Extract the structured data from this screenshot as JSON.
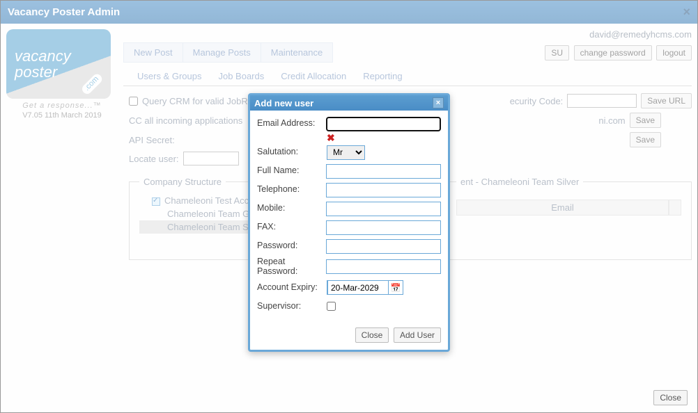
{
  "window": {
    "title": "Vacancy Poster Admin"
  },
  "logo": {
    "line1": "vacancy",
    "line2": "poster",
    "com": ".com",
    "tagline": "Get a response...™",
    "version": "V7.05 11th March 2019"
  },
  "user_email": "david@remedyhcms.com",
  "header_buttons": {
    "su": "SU",
    "change_pw": "change password",
    "logout": "logout"
  },
  "main_tabs": [
    "New Post",
    "Manage Posts",
    "Maintenance"
  ],
  "sub_tabs": [
    "Users & Groups",
    "Job Boards",
    "Credit Allocation",
    "Reporting"
  ],
  "form": {
    "query_crm_label": "Query CRM for valid JobR",
    "security_code_label": "ecurity Code:",
    "save_url_btn": "Save URL",
    "cc_label": "CC all incoming applications",
    "cc_value_tail": "ni.com",
    "save_btn": "Save",
    "api_secret_label": "API Secret:",
    "locate_user_label": "Locate user:"
  },
  "company_structure": {
    "legend": "Company Structure",
    "items": [
      "Chameleoni Test Accou",
      "Chameleoni Team G",
      "Chameleoni Team S"
    ]
  },
  "team_panel": {
    "legend_tail": "ent - Chameleoni Team Silver",
    "email_header": "Email"
  },
  "modal": {
    "title": "Add new user",
    "fields": {
      "email": "Email Address:",
      "salutation": "Salutation:",
      "salutation_value": "Mr",
      "full_name": "Full Name:",
      "telephone": "Telephone:",
      "mobile": "Mobile:",
      "fax": "FAX:",
      "password": "Password:",
      "repeat_password": "Repeat Password:",
      "account_expiry": "Account Expiry:",
      "account_expiry_value": "20-Mar-2029",
      "supervisor": "Supervisor:"
    },
    "buttons": {
      "close": "Close",
      "add_user": "Add User"
    },
    "error_marker": "✖"
  },
  "footer": {
    "close": "Close"
  }
}
